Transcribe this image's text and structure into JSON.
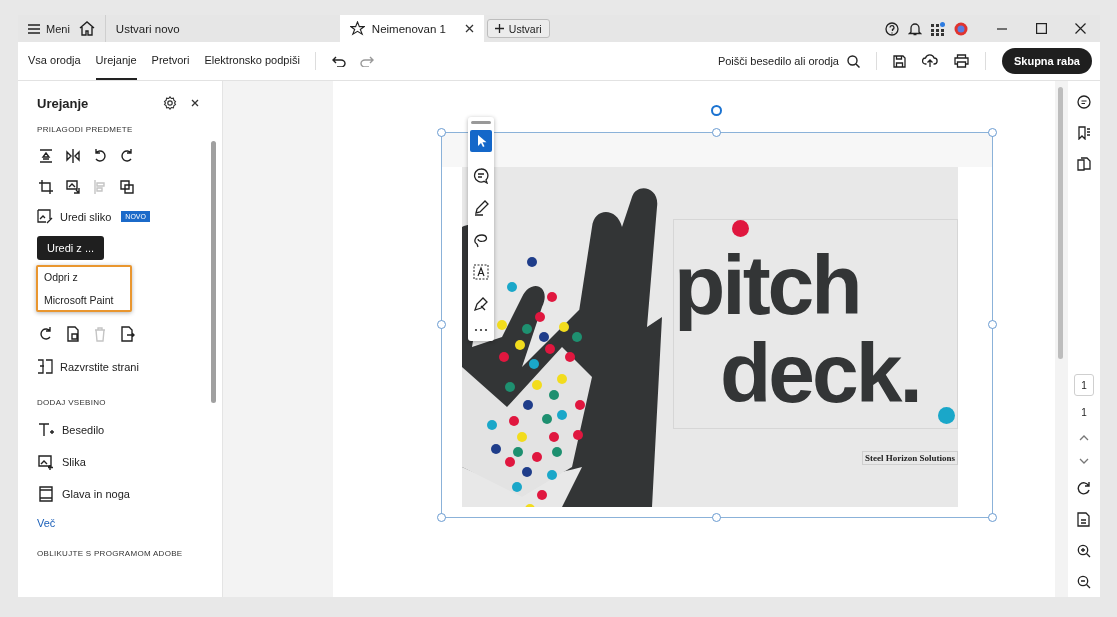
{
  "window": {
    "menu": "Meni",
    "tabs": [
      {
        "label": "Ustvari novo",
        "selected": false
      },
      {
        "label": "Neimenovan 1",
        "selected": true
      }
    ],
    "new_tab": "Ustvari"
  },
  "toolbar": {
    "tabs": [
      {
        "label": "Vsa orodja",
        "selected": false
      },
      {
        "label": "Urejanje",
        "selected": true
      },
      {
        "label": "Pretvori",
        "selected": false
      },
      {
        "label": "Elektronsko podpiši",
        "selected": false
      }
    ],
    "search": "Poišči besedilo ali orodja",
    "share": "Skupna raba"
  },
  "panel": {
    "title": "Urejanje",
    "section_1": "PRILAGODI PREDMETE",
    "icon_rows": [
      [
        {
          "kind": "flipv",
          "disabled": false
        },
        {
          "kind": "fliph",
          "disabled": false
        },
        {
          "kind": "rotl",
          "disabled": false
        },
        {
          "kind": "rotr",
          "disabled": false
        }
      ],
      [
        {
          "kind": "crop",
          "disabled": false
        },
        {
          "kind": "replace",
          "disabled": false
        },
        {
          "kind": "align",
          "disabled": true
        },
        {
          "kind": "arrange",
          "disabled": false
        }
      ]
    ],
    "edit_image": "Uredi sliko",
    "badge": "NOVO",
    "edit_with": "Uredi z ...",
    "menu": {
      "highlighted": true,
      "items": [
        "Odpri z",
        "Microsoft Paint"
      ]
    },
    "page_icons": [
      {
        "kind": "rotr",
        "disabled": false
      },
      {
        "kind": "extract",
        "disabled": false
      },
      {
        "kind": "trash",
        "disabled": true
      },
      {
        "kind": "insert",
        "disabled": false
      }
    ],
    "organize": "Razvrstite strani",
    "section_2": "DODAJ VSEBINO",
    "add_items": [
      {
        "kind": "text",
        "label": "Besedilo"
      },
      {
        "kind": "image",
        "label": "Slika"
      },
      {
        "kind": "header",
        "label": "Glava in noga"
      }
    ],
    "more": "Več",
    "section_3": "OBLIKUJTE S PROGRAMOM ADOBE"
  },
  "slide": {
    "title_lines": [
      "pitch",
      "deck."
    ],
    "company": "Steel Horizon Solutions"
  },
  "page_nav": {
    "current": "1",
    "total": "1"
  }
}
